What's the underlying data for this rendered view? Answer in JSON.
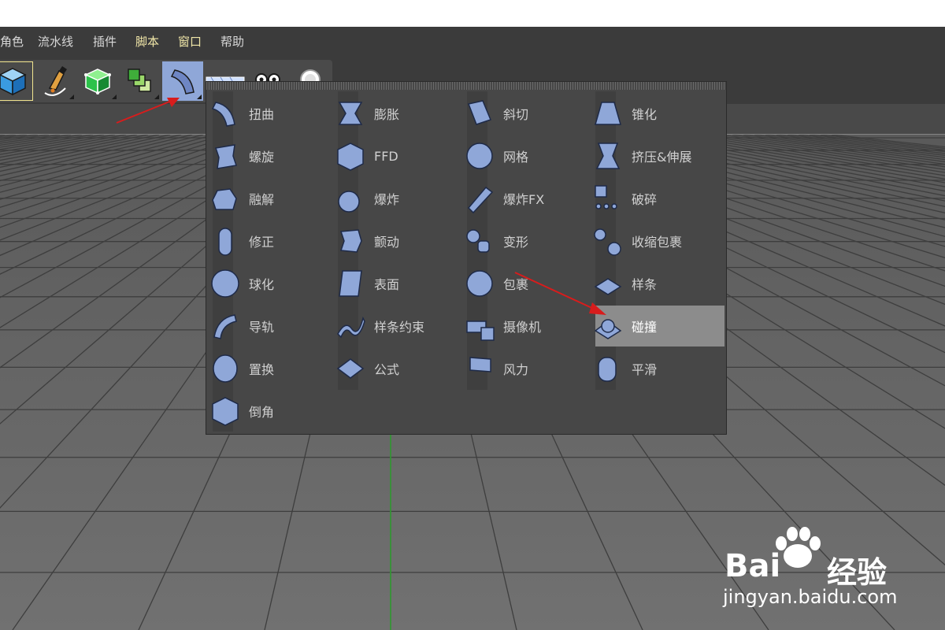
{
  "menu": [
    {
      "label": "角色",
      "hl": false
    },
    {
      "label": "流水线",
      "hl": false
    },
    {
      "label": "插件",
      "hl": false
    },
    {
      "label": "脚本",
      "hl": true
    },
    {
      "label": "窗口",
      "hl": true
    },
    {
      "label": "帮助",
      "hl": false
    }
  ],
  "toolbar": [
    {
      "icon": "cube-icon"
    },
    {
      "icon": "pen-icon"
    },
    {
      "icon": "subdivision-icon"
    },
    {
      "icon": "array-icon"
    },
    {
      "icon": "bend-deformer-icon"
    },
    {
      "icon": "floor-icon"
    },
    {
      "icon": "camera-icon"
    },
    {
      "icon": "light-icon"
    }
  ],
  "deformers": {
    "columns": [
      [
        {
          "label": "扭曲",
          "icon": "bend-icon"
        },
        {
          "label": "螺旋",
          "icon": "twist-icon"
        },
        {
          "label": "融解",
          "icon": "melt-icon"
        },
        {
          "label": "修正",
          "icon": "correction-icon"
        },
        {
          "label": "球化",
          "icon": "spherify-icon"
        },
        {
          "label": "导轨",
          "icon": "rail-icon"
        },
        {
          "label": "置换",
          "icon": "displacer-icon"
        },
        {
          "label": "倒角",
          "icon": "bevel-icon"
        }
      ],
      [
        {
          "label": "膨胀",
          "icon": "bulge-icon"
        },
        {
          "label": "FFD",
          "icon": "ffd-icon"
        },
        {
          "label": "爆炸",
          "icon": "explosion-icon"
        },
        {
          "label": "颤动",
          "icon": "jiggle-icon"
        },
        {
          "label": "表面",
          "icon": "surface-icon"
        },
        {
          "label": "样条约束",
          "icon": "spline-wrap-icon"
        },
        {
          "label": "公式",
          "icon": "formula-icon"
        }
      ],
      [
        {
          "label": "斜切",
          "icon": "shear-icon"
        },
        {
          "label": "网格",
          "icon": "mesh-icon"
        },
        {
          "label": "爆炸FX",
          "icon": "explosion-fx-icon"
        },
        {
          "label": "变形",
          "icon": "morph-icon"
        },
        {
          "label": "包裹",
          "icon": "wrap-icon"
        },
        {
          "label": "摄像机",
          "icon": "camera-deformer-icon"
        },
        {
          "label": "风力",
          "icon": "wind-icon"
        }
      ],
      [
        {
          "label": "锥化",
          "icon": "taper-icon"
        },
        {
          "label": "挤压&伸展",
          "icon": "squash-stretch-icon"
        },
        {
          "label": "破碎",
          "icon": "shatter-icon"
        },
        {
          "label": "收缩包裹",
          "icon": "shrink-wrap-icon"
        },
        {
          "label": "样条",
          "icon": "spline-deformer-icon"
        },
        {
          "label": "碰撞",
          "icon": "collision-icon",
          "hover": true
        },
        {
          "label": "平滑",
          "icon": "smoothing-icon"
        }
      ]
    ]
  },
  "watermark": {
    "brand_a": "Bai",
    "brand_b": "经验",
    "url": "jingyan.baidu.com"
  },
  "colors": {
    "menu_bg": "#3b3b3b",
    "popup_bg": "#474747",
    "highlight": "#8c8c8c",
    "icon_blue": "#8fa7d8",
    "arrow": "#d81c1c"
  }
}
